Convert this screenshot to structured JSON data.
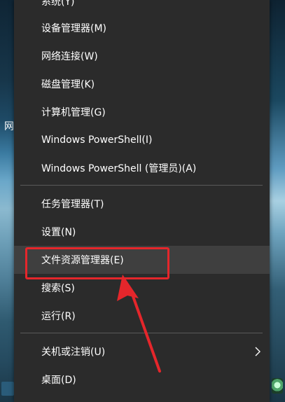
{
  "desktop": {
    "left_text": "网"
  },
  "menu": {
    "items": [
      {
        "label": "系统(Y)"
      },
      {
        "label": "设备管理器(M)"
      },
      {
        "label": "网络连接(W)"
      },
      {
        "label": "磁盘管理(K)"
      },
      {
        "label": "计算机管理(G)"
      },
      {
        "label": "Windows PowerShell(I)"
      },
      {
        "label": "Windows PowerShell (管理员)(A)"
      },
      {
        "label": "任务管理器(T)"
      },
      {
        "label": "设置(N)"
      },
      {
        "label": "文件资源管理器(E)"
      },
      {
        "label": "搜索(S)"
      },
      {
        "label": "运行(R)"
      },
      {
        "label": "关机或注销(U)"
      },
      {
        "label": "桌面(D)"
      }
    ],
    "highlighted_item": "文件资源管理器(E)"
  },
  "annotation": {
    "color": "#e5262b"
  },
  "colors": {
    "menu_bg": "#2b2b2b",
    "highlight_bg": "#3f3f3f",
    "text": "#ffffff"
  }
}
